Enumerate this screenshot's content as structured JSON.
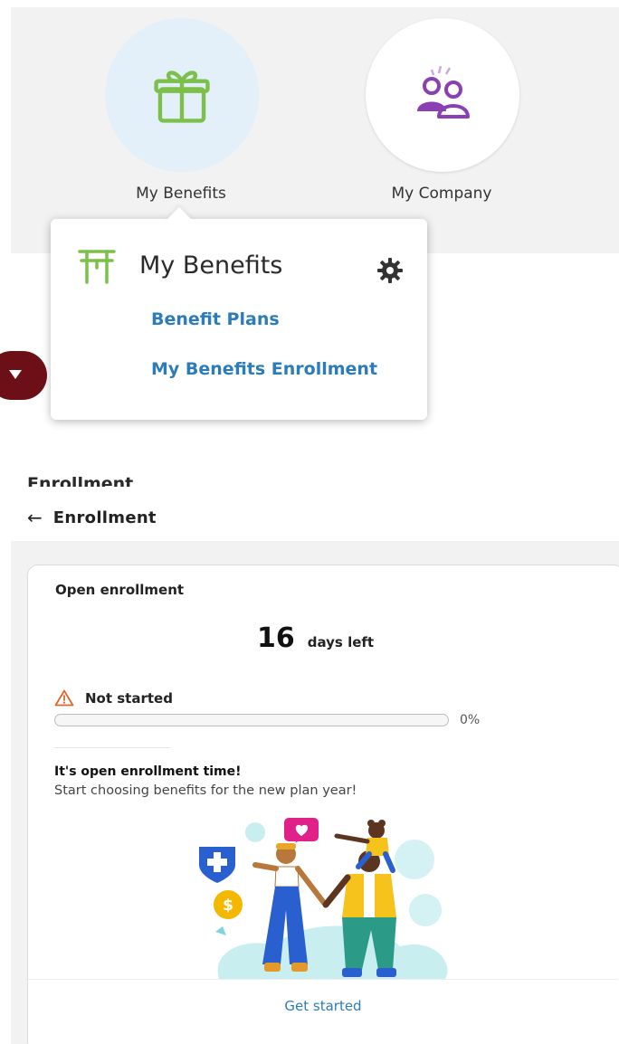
{
  "tiles": [
    {
      "label": "My Benefits",
      "icon": "gift-icon",
      "color": "#7cc04b",
      "background": "#e3eff9"
    },
    {
      "label": "My Company",
      "icon": "people-icon",
      "color": "#8a3fb3",
      "background": "#ffffff"
    }
  ],
  "menu": {
    "title": "My Benefits",
    "title_icon": "benefits-gate-icon",
    "settings_icon": "gear-icon",
    "links": [
      "Benefit Plans",
      "My Benefits Enrollment"
    ],
    "link_color": "#2b7cb9"
  },
  "page": {
    "back_icon": "arrow-left-icon",
    "title": "Enrollment"
  },
  "enrollment": {
    "heading": "Open enrollment",
    "days_left": "16",
    "days_left_suffix": "days left",
    "status_icon": "warning-icon",
    "status": "Not started",
    "progress_percent": 0,
    "progress_label": "0%",
    "message_title": "It's open enrollment time!",
    "message_body": "Start choosing benefits for the new plan year!",
    "illustration": "family-illustration",
    "cta": "Get started"
  },
  "colors": {
    "accent_green": "#7cc04b",
    "accent_purple": "#8a3fb3",
    "link_blue": "#2b7cb9",
    "maroon": "#6d0f16",
    "warning_orange": "#e0662b"
  }
}
